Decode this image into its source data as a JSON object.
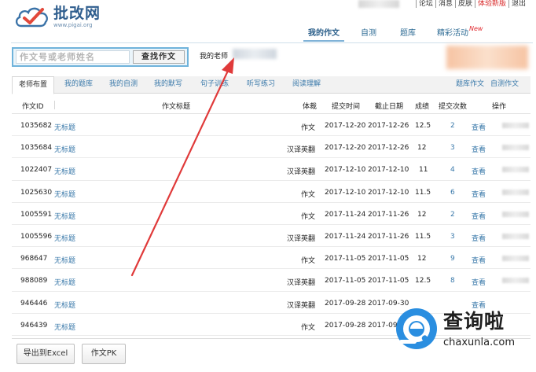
{
  "brand": {
    "name": "批改网",
    "domain": "www.pigai.org"
  },
  "toplinks": [
    "论坛",
    "消息",
    "皮肤",
    "体验新版",
    "退出"
  ],
  "nav": {
    "items": [
      "我的作文",
      "自测",
      "题库",
      "精彩活动"
    ],
    "new_badge": "New"
  },
  "search": {
    "placeholder": "作文号或老师姓名",
    "button": "查找作文",
    "teacher_label": "我的老师"
  },
  "tabs": [
    "老师布置",
    "我的题库",
    "我的自测",
    "我的默写",
    "句子训练",
    "听写练习",
    "阅读理解"
  ],
  "tabs_right": [
    "题库作文",
    "自测作文"
  ],
  "table": {
    "headers": [
      "作文ID",
      "作文标题",
      "体裁",
      "提交时间",
      "截止日期",
      "成绩",
      "提交次数",
      "操作"
    ],
    "rows": [
      {
        "id": "1035682",
        "title": "无标题",
        "genre": "作文",
        "submit": "2017-12-20",
        "deadline": "2017-12-26",
        "score": "12.5",
        "count": "2",
        "action": "查看"
      },
      {
        "id": "1035684",
        "title": "无标题",
        "genre": "汉译英翻",
        "submit": "2017-12-20",
        "deadline": "2017-12-26",
        "score": "12",
        "count": "3",
        "action": "查看"
      },
      {
        "id": "1022407",
        "title": "无标题",
        "genre": "汉译英翻",
        "submit": "2017-12-10",
        "deadline": "2017-12-10",
        "score": "11",
        "count": "4",
        "action": "查看"
      },
      {
        "id": "1025630",
        "title": "无标题",
        "genre": "作文",
        "submit": "2017-12-10",
        "deadline": "2017-12-10",
        "score": "11.5",
        "count": "6",
        "action": "查看"
      },
      {
        "id": "1005591",
        "title": "无标题",
        "genre": "作文",
        "submit": "2017-11-24",
        "deadline": "2017-11-26",
        "score": "12",
        "count": "2",
        "action": "查看"
      },
      {
        "id": "1005596",
        "title": "无标题",
        "genre": "汉译英翻",
        "submit": "2017-11-24",
        "deadline": "2017-11-26",
        "score": "11.5",
        "count": "3",
        "action": "查看"
      },
      {
        "id": "968647",
        "title": "无标题",
        "genre": "作文",
        "submit": "2017-11-05",
        "deadline": "2017-11-05",
        "score": "12",
        "count": "9",
        "action": "查看"
      },
      {
        "id": "988089",
        "title": "无标题",
        "genre": "汉译英翻",
        "submit": "2017-11-05",
        "deadline": "2017-11-05",
        "score": "12.5",
        "count": "8",
        "action": "查看"
      },
      {
        "id": "946446",
        "title": "无标题",
        "genre": "汉译英翻",
        "submit": "2017-09-28",
        "deadline": "2017-09-30",
        "score": "",
        "count": "",
        "action": "查看"
      },
      {
        "id": "946439",
        "title": "无标题",
        "genre": "作文",
        "submit": "2017-09-28",
        "deadline": "2017-09",
        "score": "",
        "count": "",
        "action": ""
      }
    ]
  },
  "footer": {
    "export_button": "导出到Excel",
    "pk_button": "作文PK"
  },
  "watermark": {
    "text": "查询啦",
    "url": "chaxunla.com"
  },
  "colors": {
    "link": "#3a79aa",
    "accent_red": "#d92b2b",
    "arrow": "#e03a3a",
    "search_border": "#6fb3db"
  }
}
